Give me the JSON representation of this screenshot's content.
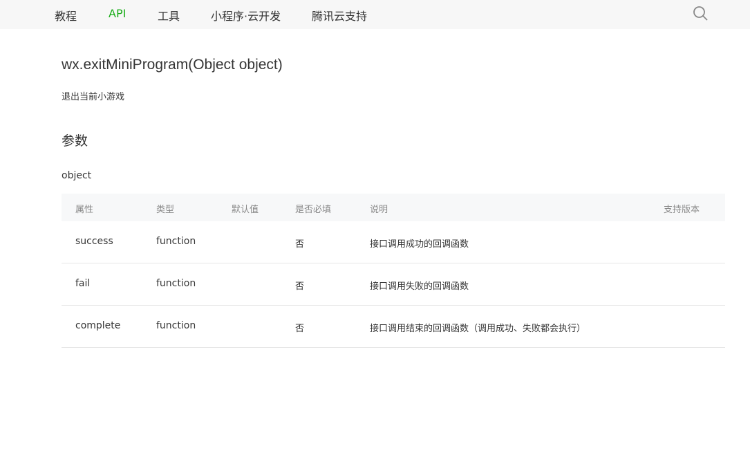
{
  "nav": {
    "items": [
      "教程",
      "API",
      "工具",
      "小程序·云开发",
      "腾讯云支持"
    ],
    "active": "API"
  },
  "api": {
    "title": "wx.exitMiniProgram(Object object)",
    "description": "退出当前小游戏"
  },
  "params": {
    "section_title": "参数",
    "object_label": "object",
    "headers": [
      "属性",
      "类型",
      "默认值",
      "是否必填",
      "说明",
      "支持版本"
    ],
    "rows": [
      {
        "prop": "success",
        "type": "function",
        "default": "",
        "required": "否",
        "desc": "接口调用成功的回调函数",
        "version": ""
      },
      {
        "prop": "fail",
        "type": "function",
        "default": "",
        "required": "否",
        "desc": "接口调用失败的回调函数",
        "version": ""
      },
      {
        "prop": "complete",
        "type": "function",
        "default": "",
        "required": "否",
        "desc": "接口调用结束的回调函数（调用成功、失败都会执行）",
        "version": ""
      }
    ]
  },
  "colors": {
    "accent": "#1aad19",
    "nav_bg": "#f7f7f7",
    "header_bg": "#f7f8f9"
  },
  "icons": {
    "search": "search-icon"
  }
}
